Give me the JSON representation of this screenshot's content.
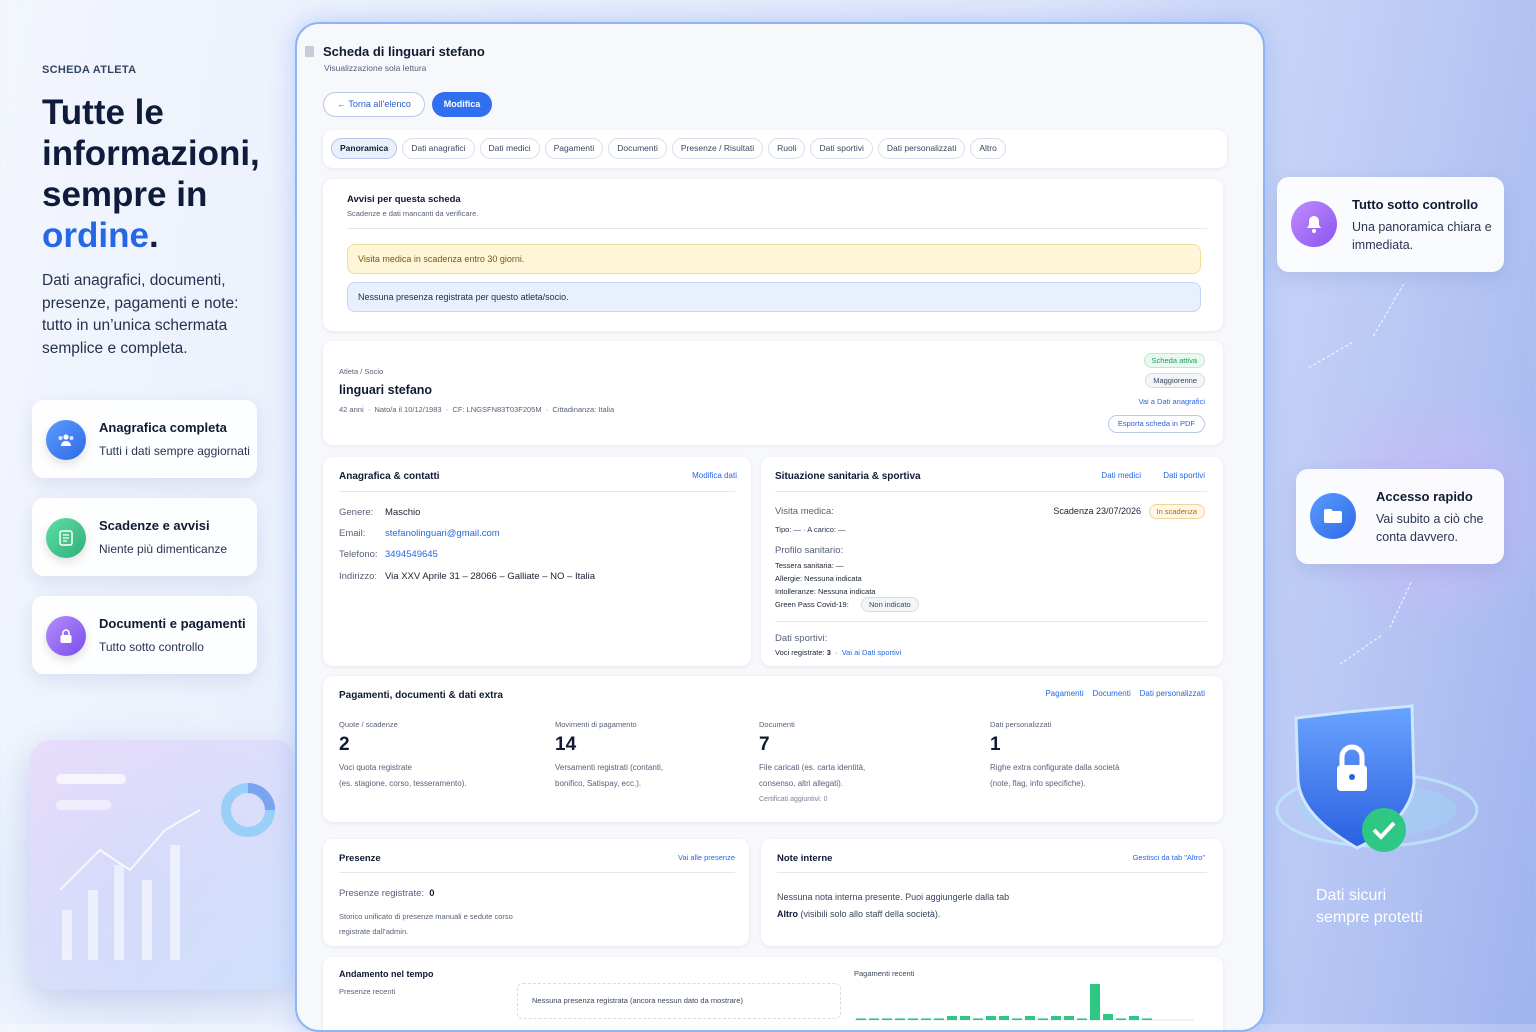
{
  "left": {
    "kicker": "SCHEDA ATLETA",
    "hero_line1": "Tutte le",
    "hero_line2": "informazioni,",
    "hero_line3": "sempre in",
    "hero_accent": "ordine",
    "hero_dot": ".",
    "lead": "Dati anagrafici, documenti, presenze, pagamenti e note: tutto in un’unica schermata semplice e completa.",
    "features": [
      {
        "title": "Anagrafica completa",
        "subtitle": "Tutti i dati sempre aggiornati",
        "icon": "users-icon",
        "color": "#3b7cf0"
      },
      {
        "title": "Scadenze e avvisi",
        "subtitle": "Niente più dimenticanze",
        "icon": "checklist-icon",
        "color": "#3cc28a"
      },
      {
        "title": "Documenti e pagamenti",
        "subtitle": "Tutto sotto controllo",
        "icon": "lock-icon",
        "color": "#8f5ef0"
      }
    ]
  },
  "header": {
    "title": "Scheda di linguari stefano",
    "subtitle": "Visualizzazione sola lettura",
    "back_label": "← Torna all’elenco",
    "edit_label": "Modifica"
  },
  "tabs": [
    "Panoramica",
    "Dati anagrafici",
    "Dati medici",
    "Pagamenti",
    "Documenti",
    "Presenze / Risultati",
    "Ruoli",
    "Dati sportivi",
    "Dati personalizzati",
    "Altro"
  ],
  "alerts": {
    "title": "Avvisi per questa scheda",
    "subtitle": "Scadenze e dati mancanti da verificare.",
    "warning": "Visita medica in scadenza entro 30 giorni.",
    "info": "Nessuna presenza registrata per questo atleta/socio."
  },
  "athlete": {
    "kind": "Atleta / Socio",
    "name": "linguari stefano",
    "meta": "42 anni  ·  Nato/a il 10/12/1983  ·  CF: LNGSFN83T03F205M  ·  Cittadinanza: Italia",
    "badge_active": "Scheda attiva",
    "badge_adult": "Maggiorenne",
    "link_personal": "Vai a Dati anagrafici",
    "export_label": "Esporta scheda in PDF"
  },
  "contacts": {
    "title": "Anagrafica & contatti",
    "edit_link": "Modifica dati",
    "gender_label": "Genere:",
    "gender": "Maschio",
    "email_label": "Email:",
    "email": "stefanolinguari@gmail.com",
    "phone_label": "Telefono:",
    "phone": "3494549645",
    "address_label": "Indirizzo:",
    "address": "Via XXV Aprile 31 – 28066 – Galliate – NO – Italia"
  },
  "health": {
    "title": "Situazione sanitaria & sportiva",
    "link_medical": "Dati medici",
    "link_sport": "Dati sportivi",
    "visit_label": "Visita medica:",
    "visit_expiry": "Scadenza 23/07/2026",
    "visit_badge": "In scadenza",
    "type_line": "Tipo: — · A carico: —",
    "profile_label": "Profilo sanitario:",
    "card_line": "Tessera sanitaria: —",
    "allergies_line": "Allergie: Nessuna indicata",
    "intolerances_line": "Intolleranze: Nessuna indicata",
    "greenpass_label": "Green Pass Covid-19:",
    "greenpass_badge": "Non indicato",
    "sport_label": "Dati sportivi:",
    "sport_count_label": "Voci registrate:",
    "sport_count": "3",
    "sport_link": "Vai ai Dati sportivi"
  },
  "extra": {
    "title": "Pagamenti, documenti & dati extra",
    "links": [
      "Pagamenti",
      "Documenti",
      "Dati personalizzati"
    ],
    "stats": [
      {
        "label": "Quote / scadenze",
        "value": "2",
        "desc1": "Voci quota registrate",
        "desc2": "(es. stagione, corso, tesseramento).",
        "extra": ""
      },
      {
        "label": "Movimenti di pagamento",
        "value": "14",
        "desc1": "Versamenti registrati (contanti,",
        "desc2": "bonifico, Satispay, ecc.).",
        "extra": ""
      },
      {
        "label": "Documenti",
        "value": "7",
        "desc1": "File caricati (es. carta identità,",
        "desc2": "consenso, altri allegati).",
        "extra": "Certificati aggiuntivi: 0"
      },
      {
        "label": "Dati personalizzati",
        "value": "1",
        "desc1": "Righe extra configurate dalla società",
        "desc2": "(note, flag, info specifiche).",
        "extra": ""
      }
    ]
  },
  "attendance": {
    "title": "Presenze",
    "link": "Vai alle presenze",
    "count_label": "Presenze registrate:",
    "count": "0",
    "desc1": "Storico unificato di presenze manuali e sedute corso",
    "desc2": "registrate dall’admin."
  },
  "notes": {
    "title": "Note interne",
    "link": "Gestisci da tab \"Altro\"",
    "text1": "Nessuna nota interna presente. Puoi aggiungerle dalla tab",
    "text2_bold": "Altro",
    "text2_rest": " (visibili solo allo staff della società)."
  },
  "trend": {
    "title": "Andamento nel tempo",
    "subtitle": "Presenze recenti",
    "empty": "Nessuna presenza registrata (ancora nessun dato da mostrare)",
    "payments_title": "Pagamenti recenti"
  },
  "chart_data": {
    "type": "bar",
    "title": "Pagamenti recenti",
    "values": [
      0.4,
      0.4,
      0.4,
      0.4,
      0.4,
      0.4,
      0.4,
      1,
      1,
      0.4,
      1,
      1,
      0.4,
      1,
      0.4,
      1,
      1,
      0.4,
      9,
      1.5,
      0.4,
      1,
      0.4
    ]
  },
  "right": {
    "card1_title": "Tutto sotto controllo",
    "card1_text": "Una panoramica chiara e immediata.",
    "card2_title": "Accesso rapido",
    "card2_text": "Vai subito a ciò che conta davvero.",
    "secure_line1": "Dati sicuri",
    "secure_line2": "sempre protetti"
  },
  "colors": {
    "accent": "#2468e6",
    "warning_bg": "#fff6d9",
    "info_bg": "#e8f0fd",
    "chart_bar": "#2ec784"
  }
}
